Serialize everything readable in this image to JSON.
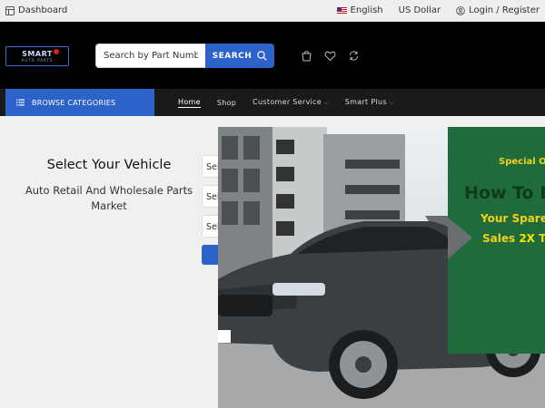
{
  "topbar": {
    "dashboard_label": "Dashboard",
    "language_label": "English",
    "currency_label": "US Dollar",
    "account_label": "Login / Register"
  },
  "header": {
    "logo_text": "SMART",
    "logo_tagline": "AUTO PARTS",
    "search_placeholder": "Search by Part Number, Product Name...",
    "search_button_label": "SEARCH"
  },
  "nav": {
    "browse_label": "BROWSE CATEGORIES",
    "links": [
      {
        "label": "Home",
        "active": true,
        "dropdown": false
      },
      {
        "label": "Shop",
        "active": false,
        "dropdown": false
      },
      {
        "label": "Customer Service",
        "active": false,
        "dropdown": true
      },
      {
        "label": "Smart Plus",
        "active": false,
        "dropdown": true
      }
    ]
  },
  "vehicle_search": {
    "title": "Select Your Vehicle",
    "subtitle": "Auto Retail And Wholesale Parts Market",
    "selects": [
      "Select",
      "Select",
      "Select"
    ]
  },
  "banner": {
    "line1": "Special Of",
    "line2": "How To E",
    "line3": "Your Spare",
    "line4_prefix": "Sales ",
    "line4_highlight": "2X",
    "line4_suffix": " T",
    "colors": {
      "panel": "#1f6b3a",
      "accent": "#f2d21a"
    }
  },
  "colors": {
    "primary": "#2d62c8",
    "header_bg": "#000000",
    "nav_bg": "#1a1a1a"
  }
}
